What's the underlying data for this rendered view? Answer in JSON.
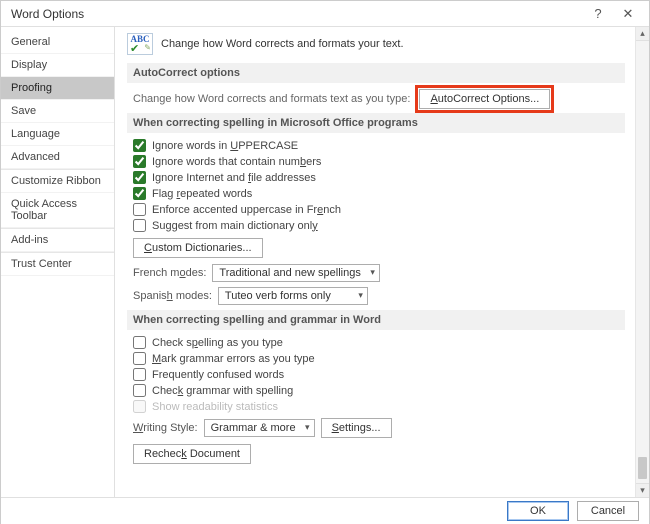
{
  "title": "Word Options",
  "sidebar": {
    "items": [
      "General",
      "Display",
      "Proofing",
      "Save",
      "Language",
      "Advanced",
      "Customize Ribbon",
      "Quick Access Toolbar",
      "Add-ins",
      "Trust Center"
    ],
    "selected_index": 2
  },
  "intro": {
    "icon_abc": "ABC",
    "text": "Change how Word corrects and formats your text."
  },
  "sections": {
    "autocorrect": {
      "head": "AutoCorrect options",
      "desc": "Change how Word corrects and formats text as you type:",
      "button": "AutoCorrect Options..."
    },
    "spelling_office": {
      "head": "When correcting spelling in Microsoft Office programs",
      "checks": [
        {
          "label_pre": "Ignore words in ",
          "label_ul": "U",
          "label_post": "PPERCASE",
          "checked": true
        },
        {
          "label_pre": "Ignore words that contain num",
          "label_ul": "b",
          "label_post": "ers",
          "checked": true
        },
        {
          "label_pre": "Ignore Internet and ",
          "label_ul": "f",
          "label_post": "ile addresses",
          "checked": true
        },
        {
          "label_pre": "Flag ",
          "label_ul": "r",
          "label_post": "epeated words",
          "checked": true
        },
        {
          "label_pre": "Enforce accented uppercase in Fr",
          "label_ul": "e",
          "label_post": "nch",
          "checked": false
        },
        {
          "label_pre": "Suggest from main dictionary onl",
          "label_ul": "y",
          "label_post": "",
          "checked": false
        }
      ],
      "custom_dict_btn": "Custom Dictionaries...",
      "french_label_pre": "French m",
      "french_label_ul": "o",
      "french_label_post": "des:",
      "french_value": "Traditional and new spellings",
      "spanish_label_pre": "Spanis",
      "spanish_label_ul": "h",
      "spanish_label_post": " modes:",
      "spanish_value": "Tuteo verb forms only"
    },
    "spelling_word": {
      "head": "When correcting spelling and grammar in Word",
      "checks": [
        {
          "label_pre": "Check s",
          "label_ul": "p",
          "label_post": "elling as you type",
          "checked": false,
          "disabled": false
        },
        {
          "label_pre": "",
          "label_ul": "M",
          "label_post": "ark grammar errors as you type",
          "checked": false,
          "disabled": false
        },
        {
          "label_pre": "Frequently confused words",
          "label_ul": "",
          "label_post": "",
          "checked": false,
          "disabled": false
        },
        {
          "label_pre": "Chec",
          "label_ul": "k",
          "label_post": " grammar with spelling",
          "checked": false,
          "disabled": false
        },
        {
          "label_pre": "Show readability statistics",
          "label_ul": "",
          "label_post": "",
          "checked": false,
          "disabled": true
        }
      ],
      "style_label_pre": "",
      "style_label_ul": "W",
      "style_label_post": "riting Style:",
      "style_value": "Grammar & more",
      "settings_btn": "Settings...",
      "recheck_btn": "Recheck Document"
    }
  },
  "footer": {
    "ok": "OK",
    "cancel": "Cancel"
  }
}
